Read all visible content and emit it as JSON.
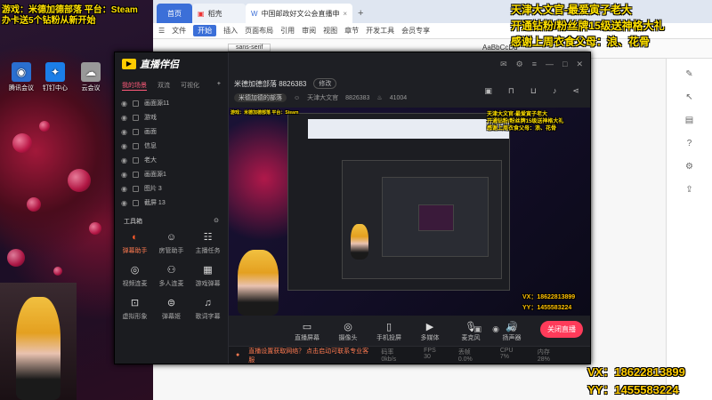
{
  "overlays": {
    "top_left_1": "游戏：米德加德部落 平台：Steam",
    "top_left_2": "办卡送5个钻粉从新开始",
    "top_right_1": "天津大文官-最爱寅子老大",
    "top_right_2": "开通钻粉/粉丝牌15级送神格大礼",
    "top_right_3": "感谢上周衣食父母：浪、花骨",
    "vx": "VX：18622813899",
    "yy": "YY：1455583224"
  },
  "desktop_icons": [
    {
      "label": "腾讯会议",
      "icon": "meeting-icon"
    },
    {
      "label": "钉钉中心",
      "icon": "dingtalk-icon"
    },
    {
      "label": "云会议",
      "icon": "cloud-icon"
    }
  ],
  "browser": {
    "tabs": [
      {
        "label": "首页"
      },
      {
        "label": "稻壳"
      },
      {
        "label": "中国邮政好文公会直播申请书"
      }
    ],
    "toolbar": [
      "文件",
      "开始",
      "插入",
      "页面布局",
      "引用",
      "审阅",
      "视图",
      "章节",
      "开发工具",
      "会员专享"
    ],
    "active_menu": "开始",
    "font_name": "sans-serif",
    "style_preview": "AaBbCcDd"
  },
  "obs": {
    "app_name": "直播伴侣",
    "scene_tabs": [
      "我的场景",
      "双流",
      "可视化"
    ],
    "sources": [
      {
        "name": "画面源11"
      },
      {
        "name": "游戏"
      },
      {
        "name": "画面"
      },
      {
        "name": "信息"
      },
      {
        "name": "老大"
      },
      {
        "name": "画面源1"
      },
      {
        "name": "图片 3"
      },
      {
        "name": "截屏 13"
      }
    ],
    "toolbox_title": "工具箱",
    "tools": [
      {
        "label": "弹幕助手",
        "icon": "danmaku-icon",
        "hot": true
      },
      {
        "label": "房管助手",
        "icon": "admin-icon"
      },
      {
        "label": "主播任务",
        "icon": "task-icon"
      },
      {
        "label": "视频连麦",
        "icon": "video-link-icon"
      },
      {
        "label": "多人连麦",
        "icon": "multi-link-icon"
      },
      {
        "label": "游戏弹幕",
        "icon": "game-danmaku-icon"
      },
      {
        "label": "虚拟形象",
        "icon": "avatar-icon"
      },
      {
        "label": "弹幕姬",
        "icon": "danmaku-bot-icon"
      },
      {
        "label": "歌词字幕",
        "icon": "lyrics-icon"
      }
    ],
    "room_title": "米德加德部落 8826383",
    "edit_label": "修改",
    "tag_label": "米德加德的部落",
    "streamer": "天津大文官",
    "room_id": "8826383",
    "followers": "41004",
    "bottom_buttons": [
      {
        "label": "直播屏幕",
        "icon": "screen-icon"
      },
      {
        "label": "摄像头",
        "icon": "camera-icon"
      },
      {
        "label": "手机投屏",
        "icon": "phone-icon"
      },
      {
        "label": "多媒体",
        "icon": "media-icon"
      },
      {
        "label": "麦克风",
        "icon": "mic-icon"
      },
      {
        "label": "扬声器",
        "icon": "speaker-icon"
      }
    ],
    "go_live": "关闭直播",
    "status_warning": "直播设置获取网络？ 点击启动可联系专业客服",
    "status_stats": [
      "码率 0kb/s",
      "FPS 30",
      "丢帧 0.0%",
      "CPU 7%",
      "内存 28%"
    ]
  }
}
